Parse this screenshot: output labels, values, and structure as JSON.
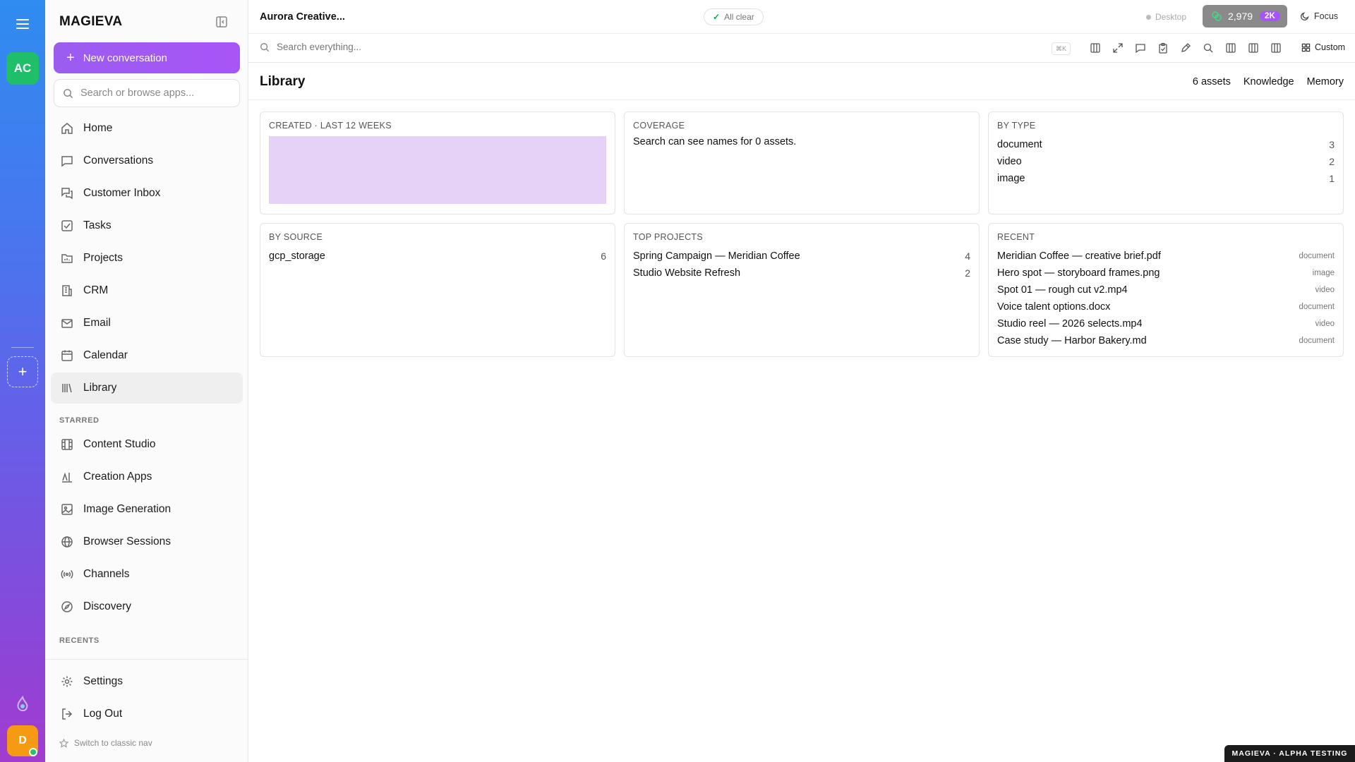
{
  "rail": {
    "workspace_initials": "AC",
    "user_initial": "D",
    "add_label": "+"
  },
  "sidebar": {
    "brand": "MAGIEVA",
    "new_conversation": "New conversation",
    "search_placeholder": "Search or browse apps...",
    "nav": [
      {
        "label": "Home",
        "icon": "home-icon"
      },
      {
        "label": "Conversations",
        "icon": "chat-icon"
      },
      {
        "label": "Customer Inbox",
        "icon": "inbox-icon"
      },
      {
        "label": "Tasks",
        "icon": "check-square-icon"
      },
      {
        "label": "Projects",
        "icon": "folder-icon"
      },
      {
        "label": "CRM",
        "icon": "building-icon"
      },
      {
        "label": "Email",
        "icon": "mail-icon"
      },
      {
        "label": "Calendar",
        "icon": "calendar-icon"
      },
      {
        "label": "Library",
        "icon": "library-icon",
        "active": true
      }
    ],
    "starred_label": "STARRED",
    "starred": [
      {
        "label": "Content Studio",
        "icon": "film-icon"
      },
      {
        "label": "Creation Apps",
        "icon": "apps-icon"
      },
      {
        "label": "Image Generation",
        "icon": "image-icon"
      },
      {
        "label": "Browser Sessions",
        "icon": "globe-icon"
      },
      {
        "label": "Channels",
        "icon": "broadcast-icon"
      },
      {
        "label": "Discovery",
        "icon": "compass-icon"
      }
    ],
    "recents_label": "RECENTS",
    "bottom": [
      {
        "label": "Settings",
        "icon": "gear-icon"
      },
      {
        "label": "Log Out",
        "icon": "logout-icon"
      }
    ],
    "switch_classic": "Switch to classic nav"
  },
  "topbar": {
    "workspace_title": "Aurora Creative...",
    "status": "All clear",
    "desktop": "Desktop",
    "credits": "2,979",
    "credits_badge": "2K",
    "focus": "Focus"
  },
  "toolbar": {
    "search_placeholder": "Search everything...",
    "shortcut": "⌘K",
    "custom": "Custom"
  },
  "library": {
    "title": "Library",
    "tabs": [
      "6 assets",
      "Knowledge",
      "Memory"
    ],
    "created": {
      "title": "CREATED · LAST 12 WEEKS"
    },
    "coverage": {
      "title": "COVERAGE",
      "text": "Search can see names for 0 assets."
    },
    "by_type": {
      "title": "BY TYPE",
      "rows": [
        {
          "label": "document",
          "count": "3"
        },
        {
          "label": "video",
          "count": "2"
        },
        {
          "label": "image",
          "count": "1"
        }
      ]
    },
    "by_source": {
      "title": "BY SOURCE",
      "rows": [
        {
          "label": "gcp_storage",
          "count": "6"
        }
      ]
    },
    "top_projects": {
      "title": "TOP PROJECTS",
      "rows": [
        {
          "label": "Spring Campaign — Meridian Coffee",
          "count": "4"
        },
        {
          "label": "Studio Website Refresh",
          "count": "2"
        }
      ]
    },
    "recent": {
      "title": "RECENT",
      "rows": [
        {
          "label": "Meridian Coffee — creative brief.pdf",
          "type": "document"
        },
        {
          "label": "Hero spot — storyboard frames.png",
          "type": "image"
        },
        {
          "label": "Spot 01 — rough cut v2.mp4",
          "type": "video"
        },
        {
          "label": "Voice talent options.docx",
          "type": "document"
        },
        {
          "label": "Studio reel — 2026 selects.mp4",
          "type": "video"
        },
        {
          "label": "Case study — Harbor Bakery.md",
          "type": "document"
        }
      ]
    }
  },
  "footer_badge": "MAGIEVA · ALPHA TESTING",
  "colors": {
    "accent": "#a855f7",
    "workspace_avatar": "#1fbf6a",
    "user_avatar": "#f59a12",
    "chart_fill": "#e6d2f6"
  }
}
